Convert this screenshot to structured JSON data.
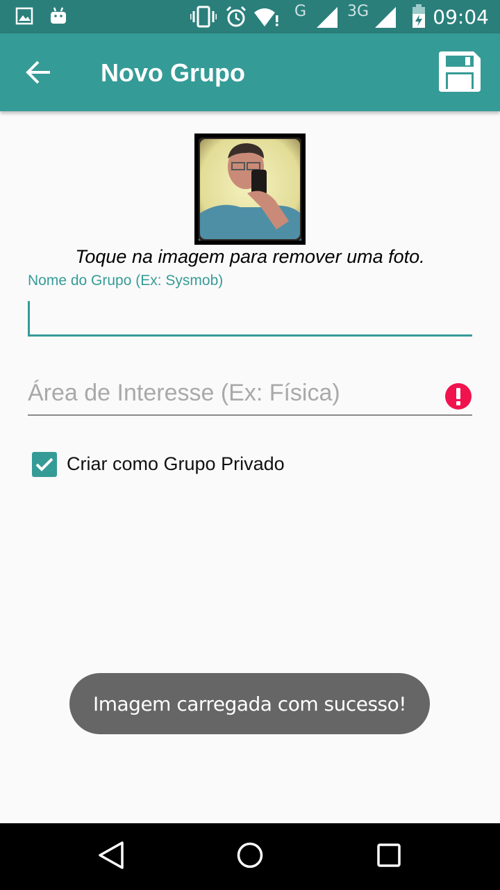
{
  "status_bar": {
    "network_g": "G",
    "network_3g": "3G",
    "time": "09:04",
    "icons": [
      "gallery-icon",
      "android-icon",
      "vibrate-icon",
      "alarm-icon",
      "wifi-icon",
      "signal-icon",
      "signal-icon",
      "battery-icon"
    ]
  },
  "app_bar": {
    "title": "Novo Grupo",
    "back_icon": "arrow-back-icon",
    "save_icon": "save-floppy-icon"
  },
  "photo": {
    "hint": "Toque na imagem para remover uma foto."
  },
  "form": {
    "group_name_label": "Nome do Grupo (Ex: Sysmob)",
    "group_name_value": "",
    "interest_placeholder": "Área de Interesse (Ex: Física)",
    "interest_error_icon": "error-icon",
    "private_checkbox_label": "Criar como Grupo Privado",
    "private_checked": true
  },
  "toast": {
    "message": "Imagem carregada com sucesso!"
  },
  "nav_bar": {
    "icons": [
      "back-triangle-icon",
      "home-circle-icon",
      "recents-square-icon"
    ]
  },
  "colors": {
    "status_bar": "#2a7f7b",
    "app_bar": "#359b97",
    "accent": "#359b97",
    "error": "#f0134d"
  }
}
